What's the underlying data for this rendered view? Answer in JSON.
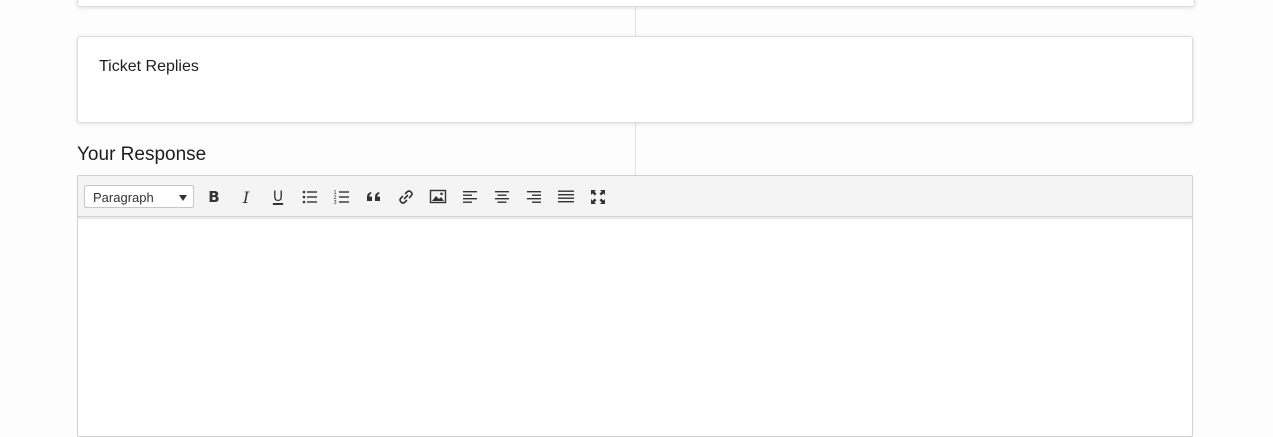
{
  "ticket_replies": {
    "title": "Ticket Replies"
  },
  "response": {
    "title": "Your Response"
  },
  "editor": {
    "format_select": {
      "value": "Paragraph"
    },
    "toolbar": {
      "bold_label": "B",
      "italic_label": "I",
      "underline_label": "U"
    }
  }
}
